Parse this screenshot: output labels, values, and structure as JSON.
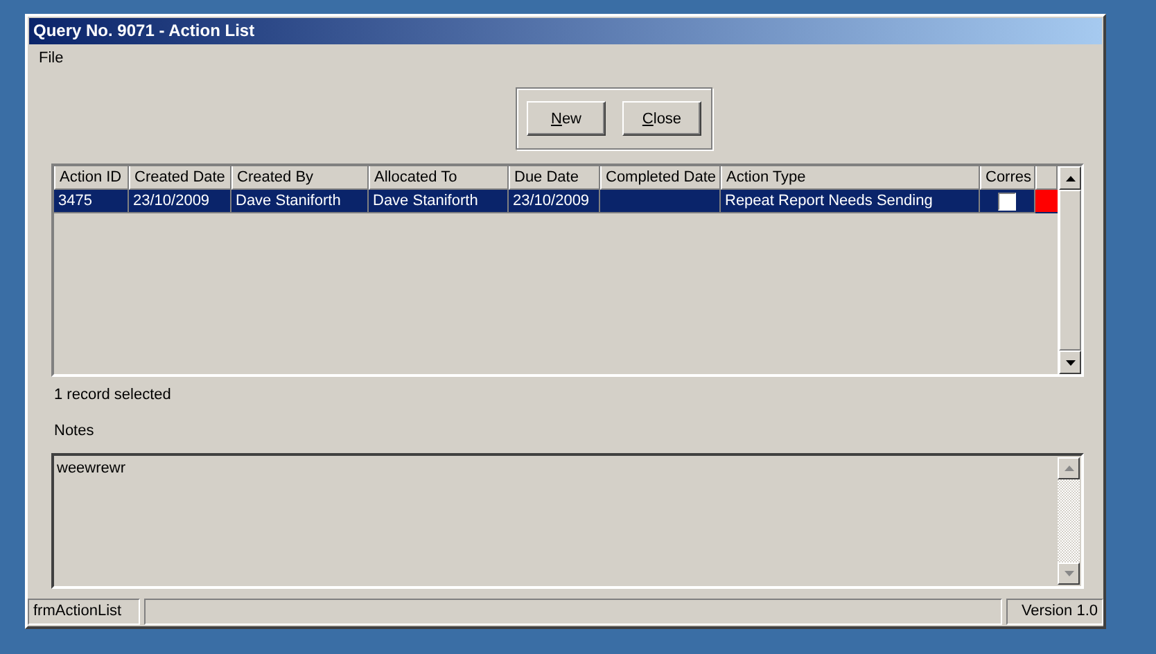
{
  "window": {
    "title": "Query No. 9071 - Action List"
  },
  "menu": [
    "File"
  ],
  "buttons": [
    {
      "label": "New"
    },
    {
      "label": "Close"
    }
  ],
  "table": {
    "columns": [
      "Action ID",
      "Created Date",
      "Created By",
      "Allocated To",
      "Due Date",
      "Completed Date",
      "Action Type",
      "Corres"
    ],
    "rows": [
      {
        "selected": true,
        "cells": [
          "3475",
          "23/10/2009",
          "Dave Staniforth",
          "Dave Staniforth",
          "23/10/2009",
          "",
          "Repeat Report Needs Sending"
        ],
        "corres_checked": false,
        "color": "#ff0000"
      }
    ]
  },
  "selection_status": "1 record selected",
  "notes": {
    "label": "Notes",
    "value": "weewrewr"
  },
  "status_bar": {
    "form_name": "frmActionList",
    "version": "Version 1.0"
  }
}
